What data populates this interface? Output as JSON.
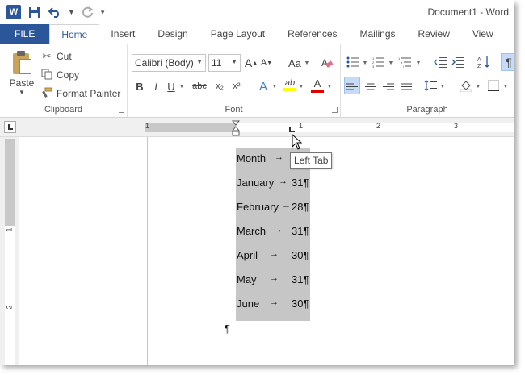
{
  "window": {
    "title": "Document1 - Word",
    "accent": "#2b579a"
  },
  "qat": {
    "app_icon": "word-icon",
    "save_icon": "save-icon",
    "undo_icon": "undo-icon",
    "redo_icon": "redo-icon",
    "customize_icon": "customize-qat-icon"
  },
  "tabs": [
    {
      "label": "FILE"
    },
    {
      "label": "Home"
    },
    {
      "label": "Insert"
    },
    {
      "label": "Design"
    },
    {
      "label": "Page Layout"
    },
    {
      "label": "References"
    },
    {
      "label": "Mailings"
    },
    {
      "label": "Review"
    },
    {
      "label": "View"
    }
  ],
  "clipboard": {
    "paste_label": "Paste",
    "cut_label": "Cut",
    "copy_label": "Copy",
    "format_painter_label": "Format Painter",
    "group_label": "Clipboard"
  },
  "font": {
    "family_value": "Calibri (Body)",
    "size_value": "11",
    "group_label": "Font",
    "bold": "B",
    "italic": "I",
    "underline": "U",
    "strike": "abc",
    "subscript": "x₂",
    "superscript": "x²",
    "grow": "A",
    "shrink": "A",
    "change_case": "Aa",
    "text_effects": "A",
    "font_color": "A",
    "highlight": "ab"
  },
  "paragraph": {
    "group_label": "Paragraph",
    "show_marks": "¶"
  },
  "ruler": {
    "numbers": [
      "1",
      "1",
      "2",
      "3"
    ]
  },
  "vruler": {
    "numbers": [
      "1",
      "2"
    ]
  },
  "tooltip": {
    "text": "Left Tab"
  },
  "document": {
    "lines": [
      {
        "month": "Month",
        "arrow": "→",
        "days": ""
      },
      {
        "month": "January",
        "arrow": "→",
        "days": "31¶"
      },
      {
        "month": "February",
        "arrow": "→",
        "days": "28¶"
      },
      {
        "month": "March",
        "arrow": "→",
        "days": "31¶"
      },
      {
        "month": "April",
        "arrow": "→",
        "days": "30¶"
      },
      {
        "month": "May",
        "arrow": "→",
        "days": "31¶"
      },
      {
        "month": "June",
        "arrow": "→",
        "days": "30¶"
      }
    ],
    "end_mark": "¶"
  }
}
